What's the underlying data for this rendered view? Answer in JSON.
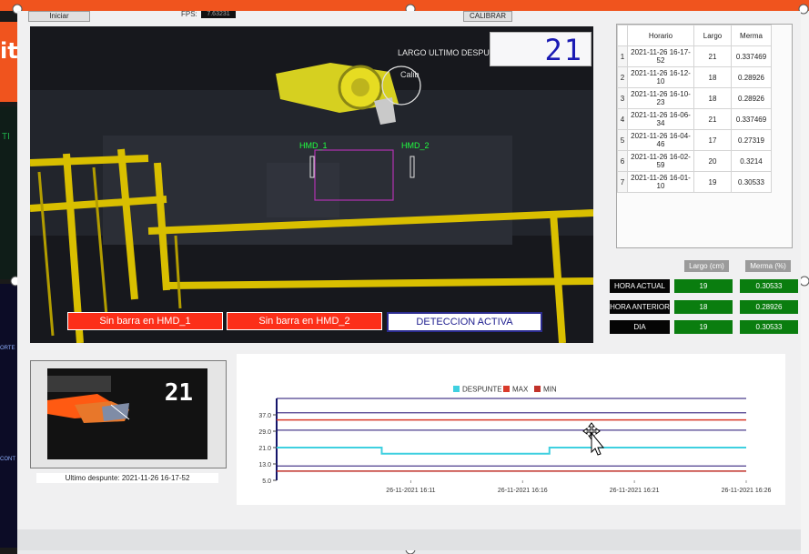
{
  "desktop": {
    "left_tab_text": "it",
    "left_text_1": "TI",
    "left_text_2": "ORTE",
    "left_text_3": "CONT"
  },
  "toolbar": {
    "start_label": "Iniciar",
    "fps_label": "FPS:",
    "fps_value": "7.63231",
    "calibrate_label": "CALIBRAR"
  },
  "camera": {
    "largo_label": "LARGO ULTIMO DESPUNTE",
    "largo_value": "21",
    "calib_text": "Calib",
    "hmd1_label": "HMD_1",
    "hmd2_label": "HMD_2",
    "alert1": "Sin barra en HMD_1",
    "alert2": "Sin barra en HMD_2",
    "alert3": "DETECCION ACTIVA"
  },
  "table": {
    "headers": [
      "Horario",
      "Largo",
      "Merma"
    ],
    "rows": [
      {
        "n": "1",
        "horario": "2021-11-26 16-17-52",
        "largo": "21",
        "merma": "0.337469"
      },
      {
        "n": "2",
        "horario": "2021-11-26 16-12-10",
        "largo": "18",
        "merma": "0.28926"
      },
      {
        "n": "3",
        "horario": "2021-11-26 16-10-23",
        "largo": "18",
        "merma": "0.28926"
      },
      {
        "n": "4",
        "horario": "2021-11-26 16-06-34",
        "largo": "21",
        "merma": "0.337469"
      },
      {
        "n": "5",
        "horario": "2021-11-26 16-04-46",
        "largo": "17",
        "merma": "0.27319"
      },
      {
        "n": "6",
        "horario": "2021-11-26 16-02-59",
        "largo": "20",
        "merma": "0.3214"
      },
      {
        "n": "7",
        "horario": "2021-11-26 16-01-10",
        "largo": "19",
        "merma": "0.30533"
      }
    ]
  },
  "stats": {
    "header_largo": "Largo (cm)",
    "header_merma": "Merma (%)",
    "rows": [
      {
        "label": "HORA ACTUAL",
        "largo": "19",
        "merma": "0.30533"
      },
      {
        "label": "HORA ANTERIOR",
        "largo": "18",
        "merma": "0.28926"
      },
      {
        "label": "DIA",
        "largo": "19",
        "merma": "0.30533"
      }
    ]
  },
  "thumbnail": {
    "value": "21",
    "caption": "Ultimo despunte: 2021-11-26 16-17-52"
  },
  "colors": {
    "accent_orange": "#f0541e",
    "alert_red": "#fc2f19",
    "status_green": "#0a7d0f",
    "largo_blue": "#1a1ab3",
    "despunte_series": "#3fd0e0",
    "max_series": "#d93b2b",
    "min_series": "#c1322a",
    "limit_line": "#4b3c8c"
  },
  "chart_data": {
    "type": "line",
    "legend": [
      "DESPUNTE",
      "MAX",
      "MIN"
    ],
    "legend_position": "top-center",
    "y_ticks": [
      "5.0",
      "13.0",
      "21.0",
      "29.0",
      "37.0"
    ],
    "x_ticks": [
      "26-11-2021 16:11",
      "26-11-2021 16:16",
      "26-11-2021 16:21",
      "26-11-2021 16:26"
    ],
    "ylim": [
      5,
      45
    ],
    "x_unit": "minutes after 16:05",
    "series": [
      {
        "name": "DESPUNTE",
        "x": [
          0,
          4.7,
          4.7,
          12.2,
          12.2,
          21
        ],
        "y": [
          21,
          21,
          18,
          18,
          21,
          21
        ]
      },
      {
        "name": "MAX",
        "x": [
          0,
          21
        ],
        "y": [
          34.5,
          34.5
        ]
      },
      {
        "name": "MIN",
        "x": [
          0,
          21
        ],
        "y": [
          9.5,
          9.5
        ]
      }
    ],
    "reference_lines": [
      12,
      29.5,
      38,
      45
    ]
  }
}
